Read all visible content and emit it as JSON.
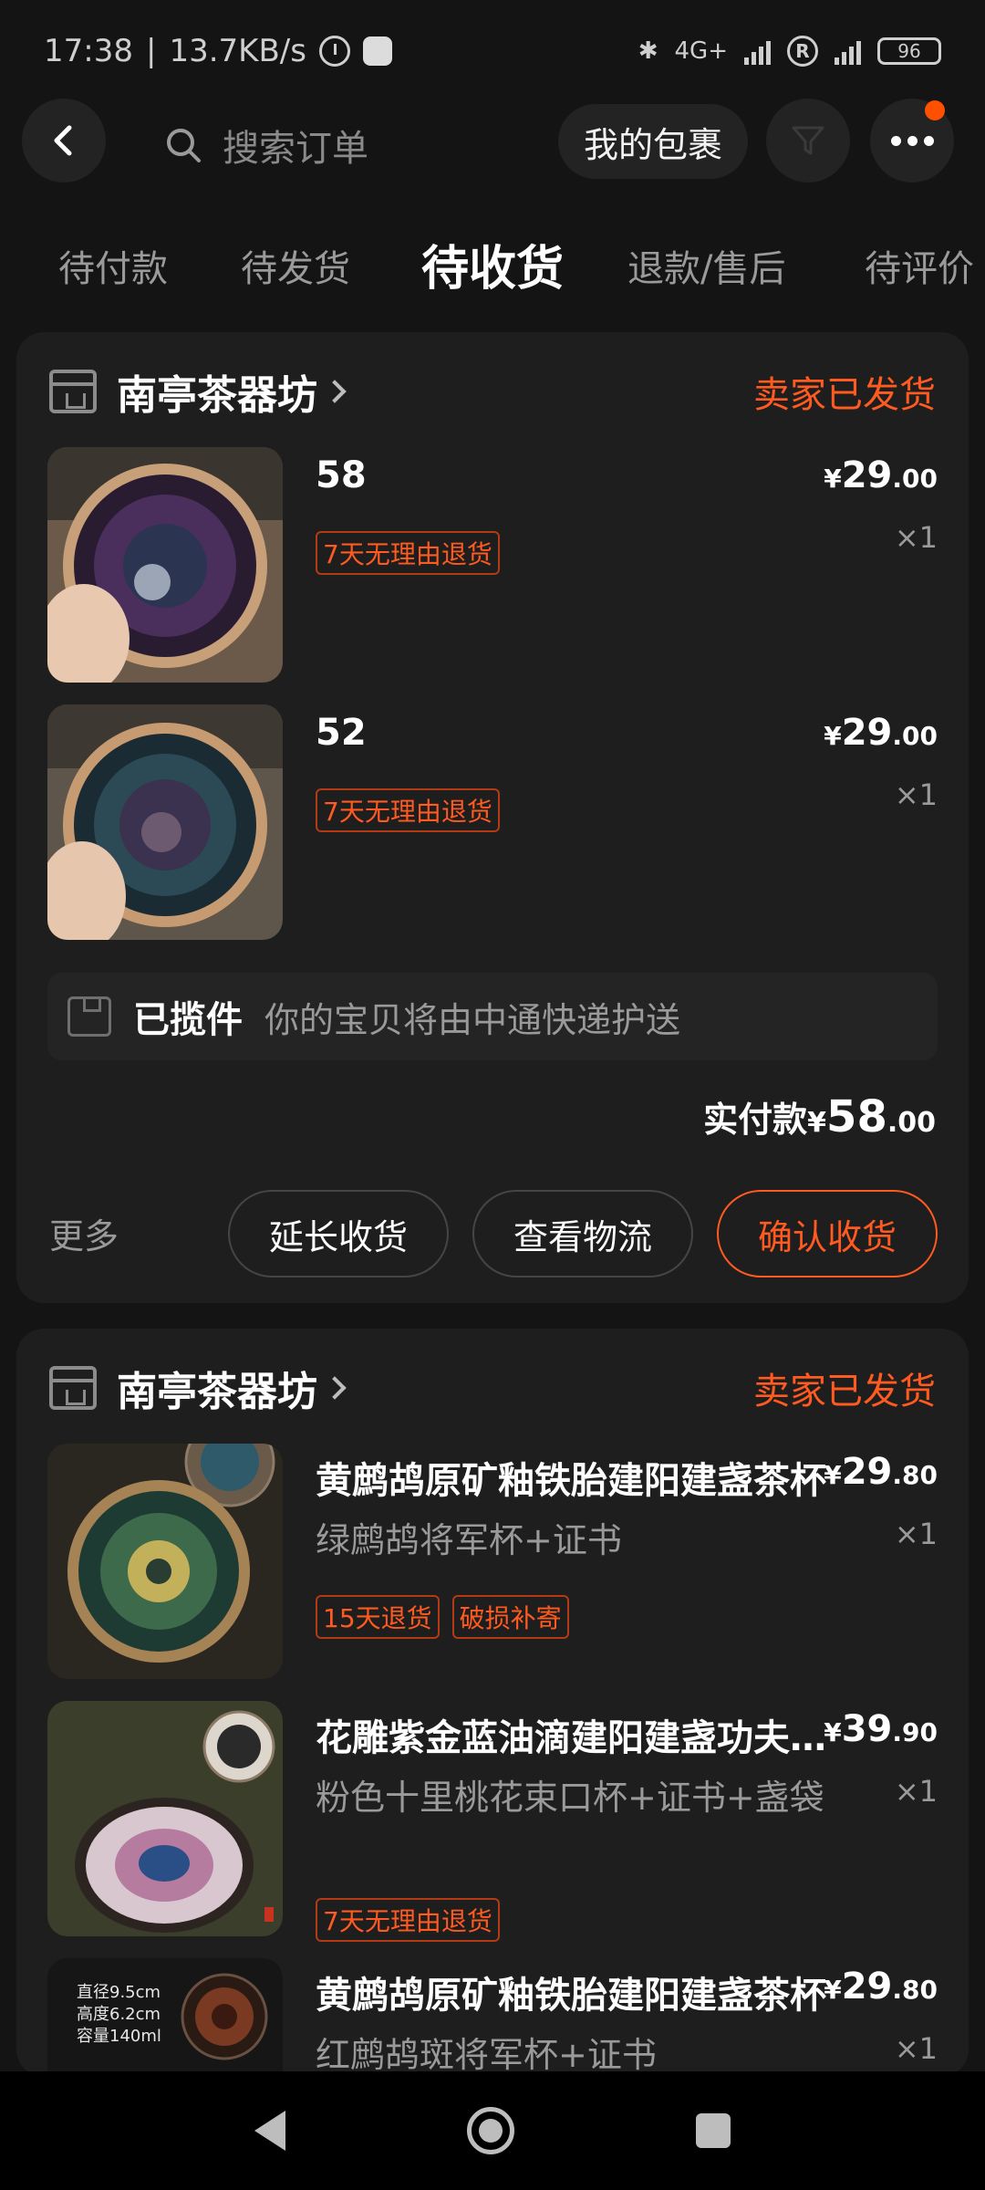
{
  "status_bar": {
    "time": "17:38",
    "speed": "13.7KB/s",
    "network": "4G+",
    "battery": "96"
  },
  "header": {
    "search_placeholder": "搜索订单",
    "my_packages": "我的包裹"
  },
  "tabs": [
    {
      "label": "待付款",
      "active": false
    },
    {
      "label": "待发货",
      "active": false
    },
    {
      "label": "待收货",
      "active": true
    },
    {
      "label": "退款/售后",
      "active": false
    },
    {
      "label": "待评价",
      "active": false
    }
  ],
  "orders": [
    {
      "shop": "南亭茶器坊",
      "status": "卖家已发货",
      "items": [
        {
          "title": "58",
          "sku": "",
          "tags": [
            "7天无理由退货"
          ],
          "price_int": "29",
          "price_dec": ".00",
          "qty": "×1"
        },
        {
          "title": "52",
          "sku": "",
          "tags": [
            "7天无理由退货"
          ],
          "price_int": "29",
          "price_dec": ".00",
          "qty": "×1"
        }
      ],
      "logistics": {
        "status": "已揽件",
        "text": "你的宝贝将由中通快递护送"
      },
      "paid": {
        "label": "实付款",
        "currency": "¥",
        "int": "58",
        "dec": ".00"
      },
      "more": "更多",
      "actions": [
        "延长收货",
        "查看物流",
        "确认收货"
      ]
    },
    {
      "shop": "南亭茶器坊",
      "status": "卖家已发货",
      "items": [
        {
          "title": "黄鹧鸪原矿釉铁胎建阳建盏茶杯",
          "sku": "绿鹧鸪将军杯+证书",
          "tags": [
            "15天退货",
            "破损补寄"
          ],
          "price_int": "29",
          "price_dec": ".80",
          "qty": "×1"
        },
        {
          "title": "花雕紫金蓝油滴建阳建盏功夫茶杯",
          "sku": "粉色十里桃花束口杯+证书+盏袋",
          "tags": [
            "7天无理由退货"
          ],
          "price_int": "39",
          "price_dec": ".90",
          "qty": "×1"
        },
        {
          "title": "黄鹧鸪原矿釉铁胎建阳建盏茶杯",
          "sku": "红鹧鸪斑将军杯+证书",
          "tags": [],
          "price_int": "29",
          "price_dec": ".80",
          "qty": "×1",
          "image_text": [
            "直径9.5cm",
            "高度6.2cm",
            "容量140ml"
          ]
        }
      ]
    }
  ],
  "currency_symbol": "¥",
  "colors": {
    "accent": "#ff5a1f",
    "background": "#141414",
    "card": "#1e1e1e"
  }
}
